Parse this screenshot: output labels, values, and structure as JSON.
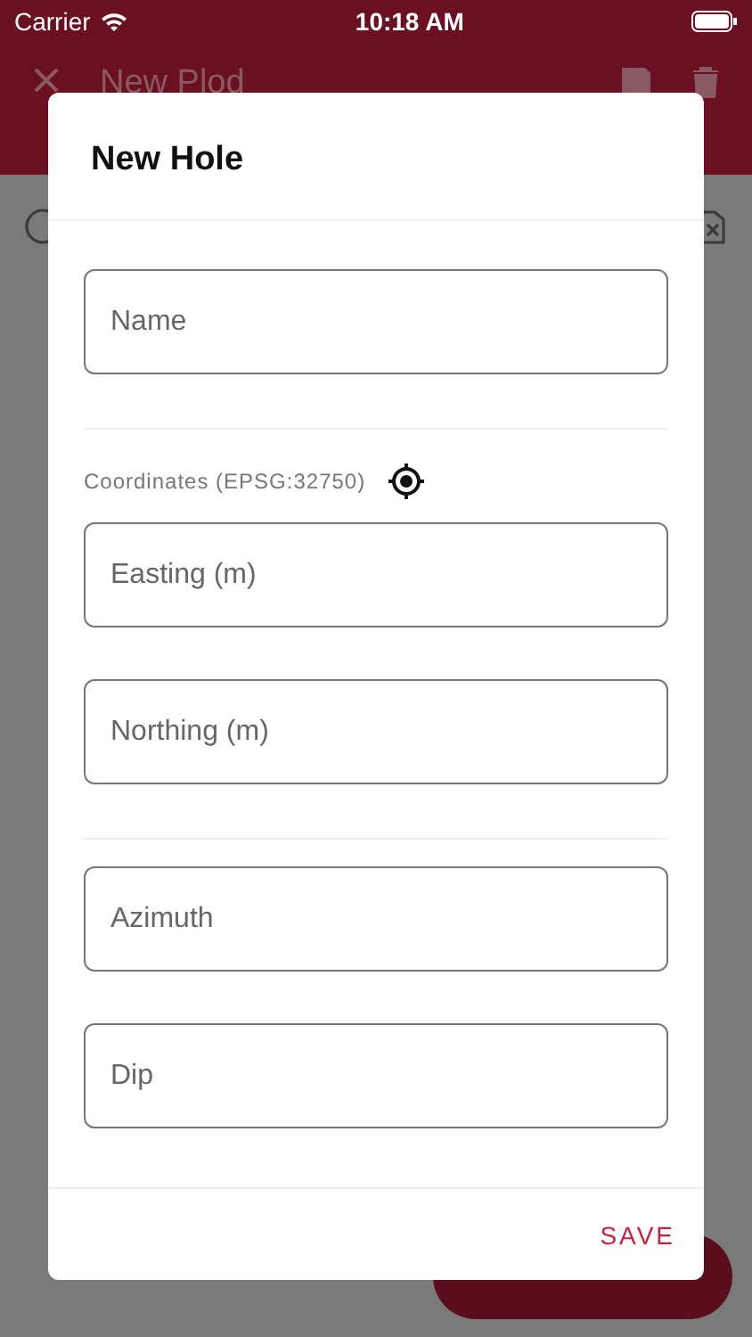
{
  "status_bar": {
    "carrier": "Carrier",
    "time": "10:18 AM"
  },
  "app_bar": {
    "title": "New Plod"
  },
  "dialog": {
    "title": "New Hole",
    "sections": [
      {
        "fields": [
          {
            "placeholder": "Name"
          }
        ]
      },
      {
        "label": "Coordinates (EPSG:32750)",
        "fields": [
          {
            "placeholder": "Easting (m)"
          },
          {
            "placeholder": "Northing (m)"
          }
        ]
      },
      {
        "fields": [
          {
            "placeholder": "Azimuth"
          },
          {
            "placeholder": "Dip"
          }
        ]
      }
    ],
    "button": "SAVE"
  }
}
